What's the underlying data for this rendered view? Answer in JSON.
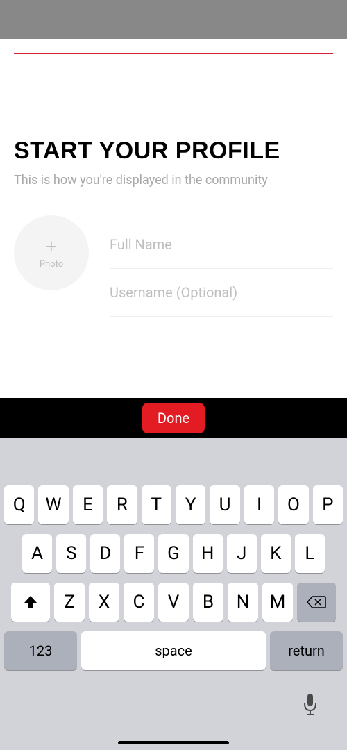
{
  "header": {
    "title": "START YOUR PROFILE",
    "subtitle": "This is how you're displayed in the community"
  },
  "photo": {
    "icon": "+",
    "label": "Photo"
  },
  "inputs": {
    "fullname_placeholder": "Full Name",
    "fullname_value": "",
    "username_placeholder": "Username (Optional)",
    "username_value": ""
  },
  "accessory": {
    "done_label": "Done"
  },
  "keyboard": {
    "row1": [
      "Q",
      "W",
      "E",
      "R",
      "T",
      "Y",
      "U",
      "I",
      "O",
      "P"
    ],
    "row2": [
      "A",
      "S",
      "D",
      "F",
      "G",
      "H",
      "J",
      "K",
      "L"
    ],
    "row3": [
      "Z",
      "X",
      "C",
      "V",
      "B",
      "N",
      "M"
    ],
    "numbers_label": "123",
    "space_label": "space",
    "return_label": "return"
  }
}
